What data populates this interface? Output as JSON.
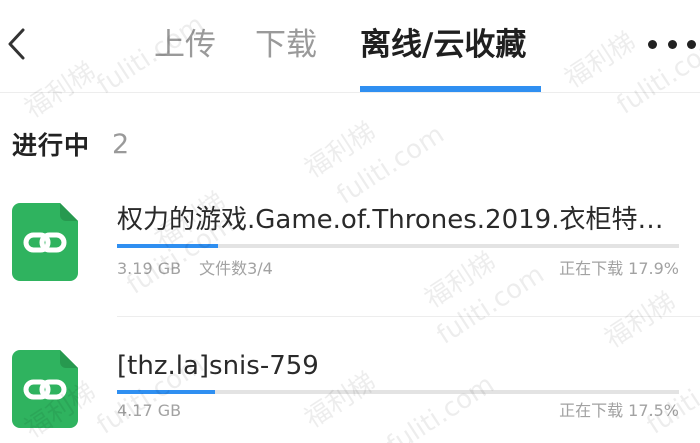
{
  "header": {
    "back_icon": "chevron-left-icon",
    "tabs": [
      {
        "label": "上传",
        "active": false
      },
      {
        "label": "下载",
        "active": false
      },
      {
        "label": "离线/云收藏",
        "active": true
      }
    ],
    "more_icon": "more-dots-icon"
  },
  "colors": {
    "accent": "#2f8ff1",
    "file_icon": "#2fb35f",
    "text_primary": "#222222",
    "text_secondary": "#a2a2a2"
  },
  "section": {
    "label": "进行中",
    "count": "2"
  },
  "tasks": [
    {
      "title": "权力的游戏.Game.of.Thrones.2019.衣柜特…",
      "size": "3.19 GB",
      "files": "文件数3/4",
      "status": "正在下载 17.9%",
      "progress": 0.179,
      "icon": "link-file-icon"
    },
    {
      "title": "[thz.la]snis-759",
      "size": "4.17 GB",
      "status": "正在下载 17.5%",
      "progress": 0.175,
      "icon": "link-file-icon"
    }
  ],
  "watermark": {
    "cn": "福利梯",
    "en": "fuliti.com"
  }
}
